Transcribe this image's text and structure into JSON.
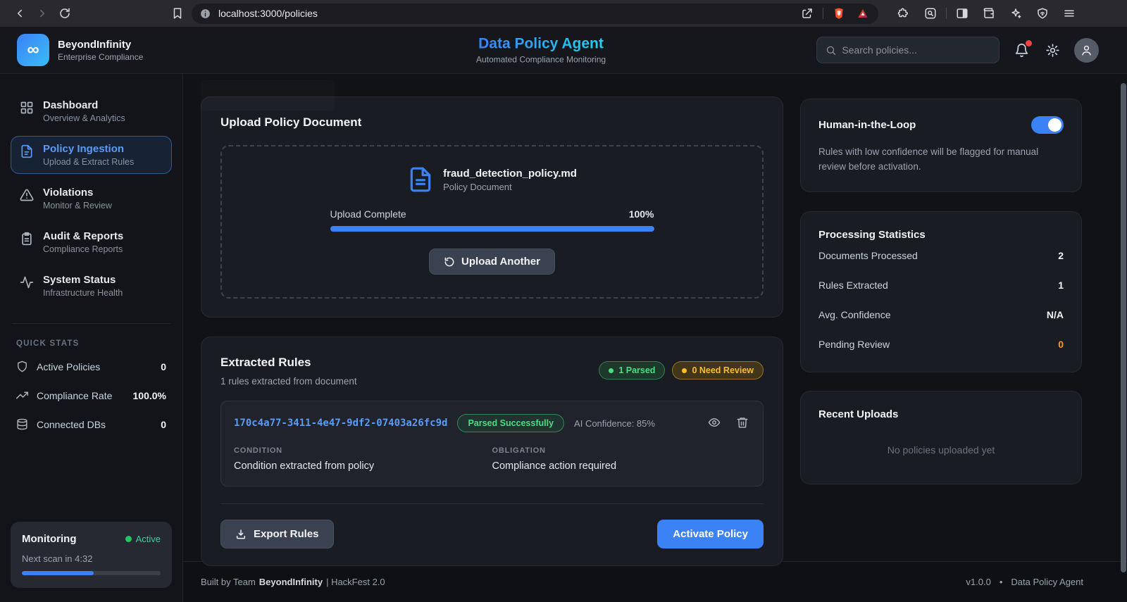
{
  "browser": {
    "url": "localhost:3000/policies"
  },
  "brand": {
    "name": "BeyondInfinity",
    "tagline": "Enterprise Compliance",
    "logo_glyph": "∞"
  },
  "header": {
    "title": "Data Policy Agent",
    "subtitle": "Automated Compliance Monitoring",
    "search_placeholder": "Search policies..."
  },
  "sidebar": {
    "items": [
      {
        "label": "Dashboard",
        "sub": "Overview & Analytics"
      },
      {
        "label": "Policy Ingestion",
        "sub": "Upload & Extract Rules"
      },
      {
        "label": "Violations",
        "sub": "Monitor & Review"
      },
      {
        "label": "Audit & Reports",
        "sub": "Compliance Reports"
      },
      {
        "label": "System Status",
        "sub": "Infrastructure Health"
      }
    ],
    "quick_stats_heading": "QUICK STATS",
    "quick_stats": [
      {
        "label": "Active Policies",
        "value": "0"
      },
      {
        "label": "Compliance Rate",
        "value": "100.0%"
      },
      {
        "label": "Connected DBs",
        "value": "0"
      }
    ],
    "monitoring": {
      "title": "Monitoring",
      "status": "Active",
      "next_scan": "Next scan in 4:32",
      "progress_pct": 52
    }
  },
  "upload": {
    "title": "Upload Policy Document",
    "file_name": "fraud_detection_policy.md",
    "file_type": "Policy Document",
    "progress_label": "Upload Complete",
    "progress_value": "100%",
    "progress_pct": 100,
    "button": "Upload Another"
  },
  "rules": {
    "title": "Extracted Rules",
    "subtitle": "1 rules extracted from document",
    "badge_parsed": "1 Parsed",
    "badge_review": "0 Need Review",
    "rule": {
      "id": "170c4a77-3411-4e47-9df2-07403a26fc9d",
      "status": "Parsed Successfully",
      "confidence": "AI Confidence: 85%",
      "condition_label": "CONDITION",
      "condition": "Condition extracted from policy",
      "obligation_label": "OBLIGATION",
      "obligation": "Compliance action required"
    },
    "export_button": "Export Rules",
    "activate_button": "Activate Policy"
  },
  "panel": {
    "hitl": {
      "title": "Human-in-the-Loop",
      "toggle_on": true,
      "description": "Rules with low confidence will be flagged for manual review before activation."
    },
    "stats": {
      "title": "Processing Statistics",
      "rows": [
        {
          "label": "Documents Processed",
          "value": "2"
        },
        {
          "label": "Rules Extracted",
          "value": "1"
        },
        {
          "label": "Avg. Confidence",
          "value": "N/A"
        },
        {
          "label": "Pending Review",
          "value": "0"
        }
      ]
    },
    "recent": {
      "title": "Recent Uploads",
      "empty": "No policies uploaded yet"
    }
  },
  "footer": {
    "built_prefix": "Built by Team",
    "team": "BeyondInfinity",
    "built_suffix": "| HackFest 2.0",
    "version": "v1.0.0",
    "separator": "•",
    "app_name": "Data Policy Agent"
  },
  "colors": {
    "accent_blue": "#3b82f6",
    "accent_cyan": "#22d3ee",
    "success_green": "#4ade80",
    "warning_yellow": "#fbbf24",
    "pending_orange": "#f59e0b",
    "notification_red": "#ef4444"
  }
}
